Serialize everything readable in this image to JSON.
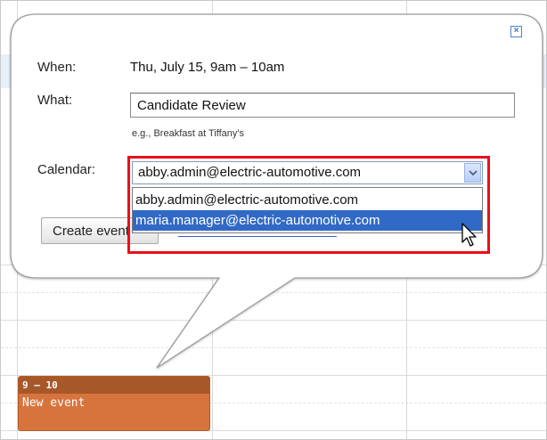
{
  "dialog": {
    "close_icon": "close-x-icon",
    "when_label": "When:",
    "when_value": "Thu, July 15, 9am – 10am",
    "what_label": "What:",
    "what_value": "Candidate Review",
    "hint": "e.g., Breakfast at Tiffany's",
    "calendar_label": "Calendar:",
    "calendar_selected": "abby.admin@electric-automotive.com",
    "calendar_options": [
      "abby.admin@electric-automotive.com",
      "maria.manager@electric-automotive.com"
    ],
    "create_label": "Create event"
  },
  "event": {
    "time": "9 – 10",
    "title": "New event"
  },
  "colors": {
    "highlight": "#e8101a",
    "selection": "#3169c6",
    "event": "#d7743d",
    "event_header": "#a75829"
  }
}
